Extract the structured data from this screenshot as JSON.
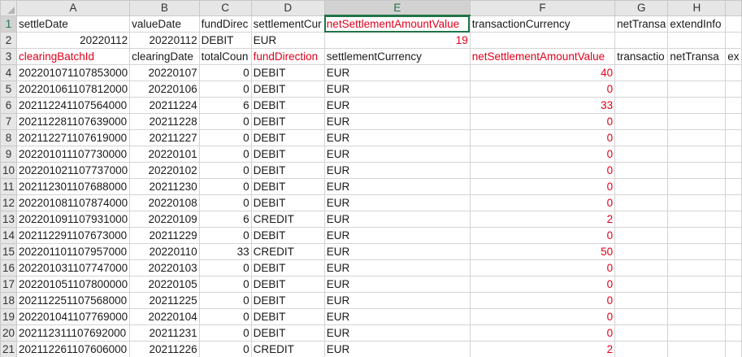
{
  "columns": [
    "A",
    "B",
    "C",
    "D",
    "E",
    "F",
    "G",
    "H"
  ],
  "selected_column": "E",
  "selected_row": "1",
  "rows": [
    {
      "n": "1",
      "cells": [
        {
          "v": "settleDate"
        },
        {
          "v": "valueDate"
        },
        {
          "v": "fundDirec"
        },
        {
          "v": "settlementCur"
        },
        {
          "v": "netSettlementAmountValue",
          "red": true
        },
        {
          "v": "transactionCurrency"
        },
        {
          "v": "netTransa"
        },
        {
          "v": "extendInfo"
        }
      ]
    },
    {
      "n": "2",
      "cells": [
        {
          "v": "20220112",
          "num": true
        },
        {
          "v": "20220112",
          "num": true
        },
        {
          "v": "DEBIT"
        },
        {
          "v": "EUR"
        },
        {
          "v": "19",
          "num": true,
          "red": true
        },
        {
          "v": ""
        },
        {
          "v": ""
        },
        {
          "v": ""
        }
      ]
    },
    {
      "n": "3",
      "cells": [
        {
          "v": "clearingBatchId",
          "red": true
        },
        {
          "v": "clearingDate"
        },
        {
          "v": "totalCoun"
        },
        {
          "v": "fundDirection",
          "red": true
        },
        {
          "v": "settlementCurrency"
        },
        {
          "v": "netSettlementAmountValue",
          "red": true
        },
        {
          "v": "transactio"
        },
        {
          "v": "netTransa"
        },
        {
          "v": "ex"
        }
      ]
    },
    {
      "n": "4",
      "cells": [
        {
          "v": "202201071107853000"
        },
        {
          "v": "20220107",
          "num": true
        },
        {
          "v": "0",
          "num": true
        },
        {
          "v": "DEBIT"
        },
        {
          "v": "EUR"
        },
        {
          "v": "40",
          "num": true,
          "red": true
        },
        {
          "v": ""
        },
        {
          "v": ""
        }
      ]
    },
    {
      "n": "5",
      "cells": [
        {
          "v": "202201061107812000"
        },
        {
          "v": "20220106",
          "num": true
        },
        {
          "v": "0",
          "num": true
        },
        {
          "v": "DEBIT"
        },
        {
          "v": "EUR"
        },
        {
          "v": "0",
          "num": true,
          "red": true
        },
        {
          "v": ""
        },
        {
          "v": ""
        }
      ]
    },
    {
      "n": "6",
      "cells": [
        {
          "v": "202112241107564000"
        },
        {
          "v": "20211224",
          "num": true
        },
        {
          "v": "6",
          "num": true
        },
        {
          "v": "DEBIT"
        },
        {
          "v": "EUR"
        },
        {
          "v": "33",
          "num": true,
          "red": true
        },
        {
          "v": ""
        },
        {
          "v": ""
        }
      ]
    },
    {
      "n": "7",
      "cells": [
        {
          "v": "202112281107639000"
        },
        {
          "v": "20211228",
          "num": true
        },
        {
          "v": "0",
          "num": true
        },
        {
          "v": "DEBIT"
        },
        {
          "v": "EUR"
        },
        {
          "v": "0",
          "num": true,
          "red": true
        },
        {
          "v": ""
        },
        {
          "v": ""
        }
      ]
    },
    {
      "n": "8",
      "cells": [
        {
          "v": "202112271107619000"
        },
        {
          "v": "20211227",
          "num": true
        },
        {
          "v": "0",
          "num": true
        },
        {
          "v": "DEBIT"
        },
        {
          "v": "EUR"
        },
        {
          "v": "0",
          "num": true,
          "red": true
        },
        {
          "v": ""
        },
        {
          "v": ""
        }
      ]
    },
    {
      "n": "9",
      "cells": [
        {
          "v": "202201011107730000"
        },
        {
          "v": "20220101",
          "num": true
        },
        {
          "v": "0",
          "num": true
        },
        {
          "v": "DEBIT"
        },
        {
          "v": "EUR"
        },
        {
          "v": "0",
          "num": true,
          "red": true
        },
        {
          "v": ""
        },
        {
          "v": ""
        }
      ]
    },
    {
      "n": "10",
      "cells": [
        {
          "v": "202201021107737000"
        },
        {
          "v": "20220102",
          "num": true
        },
        {
          "v": "0",
          "num": true
        },
        {
          "v": "DEBIT"
        },
        {
          "v": "EUR"
        },
        {
          "v": "0",
          "num": true,
          "red": true
        },
        {
          "v": ""
        },
        {
          "v": ""
        }
      ]
    },
    {
      "n": "11",
      "cells": [
        {
          "v": "202112301107688000"
        },
        {
          "v": "20211230",
          "num": true
        },
        {
          "v": "0",
          "num": true
        },
        {
          "v": "DEBIT"
        },
        {
          "v": "EUR"
        },
        {
          "v": "0",
          "num": true,
          "red": true
        },
        {
          "v": ""
        },
        {
          "v": ""
        }
      ]
    },
    {
      "n": "12",
      "cells": [
        {
          "v": "202201081107874000"
        },
        {
          "v": "20220108",
          "num": true
        },
        {
          "v": "0",
          "num": true
        },
        {
          "v": "DEBIT"
        },
        {
          "v": "EUR"
        },
        {
          "v": "0",
          "num": true,
          "red": true
        },
        {
          "v": ""
        },
        {
          "v": ""
        }
      ]
    },
    {
      "n": "13",
      "cells": [
        {
          "v": "202201091107931000"
        },
        {
          "v": "20220109",
          "num": true
        },
        {
          "v": "6",
          "num": true
        },
        {
          "v": "CREDIT"
        },
        {
          "v": "EUR"
        },
        {
          "v": "2",
          "num": true,
          "red": true
        },
        {
          "v": ""
        },
        {
          "v": ""
        }
      ]
    },
    {
      "n": "14",
      "cells": [
        {
          "v": "202112291107673000"
        },
        {
          "v": "20211229",
          "num": true
        },
        {
          "v": "0",
          "num": true
        },
        {
          "v": "DEBIT"
        },
        {
          "v": "EUR"
        },
        {
          "v": "0",
          "num": true,
          "red": true
        },
        {
          "v": ""
        },
        {
          "v": ""
        }
      ]
    },
    {
      "n": "15",
      "cells": [
        {
          "v": "202201101107957000"
        },
        {
          "v": "20220110",
          "num": true
        },
        {
          "v": "33",
          "num": true
        },
        {
          "v": "CREDIT"
        },
        {
          "v": "EUR"
        },
        {
          "v": "50",
          "num": true,
          "red": true
        },
        {
          "v": ""
        },
        {
          "v": ""
        }
      ]
    },
    {
      "n": "16",
      "cells": [
        {
          "v": "202201031107747000"
        },
        {
          "v": "20220103",
          "num": true
        },
        {
          "v": "0",
          "num": true
        },
        {
          "v": "DEBIT"
        },
        {
          "v": "EUR"
        },
        {
          "v": "0",
          "num": true,
          "red": true
        },
        {
          "v": ""
        },
        {
          "v": ""
        }
      ]
    },
    {
      "n": "17",
      "cells": [
        {
          "v": "202201051107800000"
        },
        {
          "v": "20220105",
          "num": true
        },
        {
          "v": "0",
          "num": true
        },
        {
          "v": "DEBIT"
        },
        {
          "v": "EUR"
        },
        {
          "v": "0",
          "num": true,
          "red": true
        },
        {
          "v": ""
        },
        {
          "v": ""
        }
      ]
    },
    {
      "n": "18",
      "cells": [
        {
          "v": "202112251107568000"
        },
        {
          "v": "20211225",
          "num": true
        },
        {
          "v": "0",
          "num": true
        },
        {
          "v": "DEBIT"
        },
        {
          "v": "EUR"
        },
        {
          "v": "0",
          "num": true,
          "red": true
        },
        {
          "v": ""
        },
        {
          "v": ""
        }
      ]
    },
    {
      "n": "19",
      "cells": [
        {
          "v": "202201041107769000"
        },
        {
          "v": "20220104",
          "num": true
        },
        {
          "v": "0",
          "num": true
        },
        {
          "v": "DEBIT"
        },
        {
          "v": "EUR"
        },
        {
          "v": "0",
          "num": true,
          "red": true
        },
        {
          "v": ""
        },
        {
          "v": ""
        }
      ]
    },
    {
      "n": "20",
      "cells": [
        {
          "v": "202112311107692000"
        },
        {
          "v": "20211231",
          "num": true
        },
        {
          "v": "0",
          "num": true
        },
        {
          "v": "DEBIT"
        },
        {
          "v": "EUR"
        },
        {
          "v": "0",
          "num": true,
          "red": true
        },
        {
          "v": ""
        },
        {
          "v": ""
        }
      ]
    },
    {
      "n": "21",
      "cells": [
        {
          "v": "202112261107606000"
        },
        {
          "v": "20211226",
          "num": true
        },
        {
          "v": "0",
          "num": true
        },
        {
          "v": "CREDIT"
        },
        {
          "v": "EUR"
        },
        {
          "v": "2",
          "num": true,
          "red": true
        },
        {
          "v": ""
        },
        {
          "v": ""
        }
      ]
    }
  ]
}
